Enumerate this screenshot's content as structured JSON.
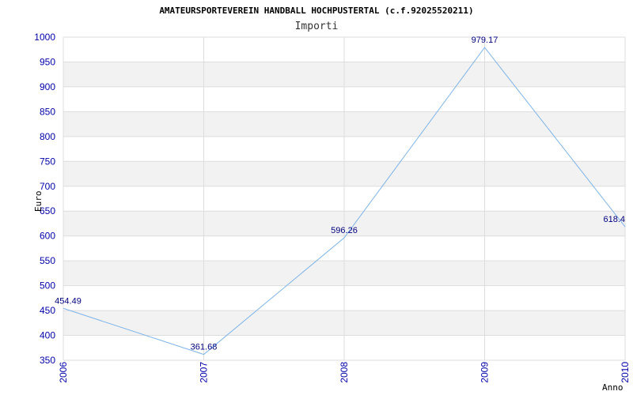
{
  "chart_data": {
    "type": "line",
    "title": "AMATEURSPORTEVEREIN HANDBALL HOCHPUSTERTAL (c.f.92025520211)",
    "subtitle": "Importi",
    "xlabel": "Anno",
    "ylabel": "Euro",
    "x": [
      "2006",
      "2007",
      "2008",
      "2009",
      "2010"
    ],
    "values": [
      454.49,
      361.68,
      596.26,
      979.17,
      618.4
    ],
    "data_labels": [
      "454.49",
      "361.68",
      "596.26",
      "979.17",
      "618.4"
    ],
    "ylim": [
      350,
      1000
    ],
    "yticks": [
      350,
      400,
      450,
      500,
      550,
      600,
      650,
      700,
      750,
      800,
      850,
      900,
      950,
      1000
    ],
    "grid": true,
    "colors": {
      "line": "#7db4ea",
      "band": "#f2f2f2",
      "grid": "#dddddd",
      "tick_text": "#0000aa",
      "data_label": "#000080"
    }
  }
}
